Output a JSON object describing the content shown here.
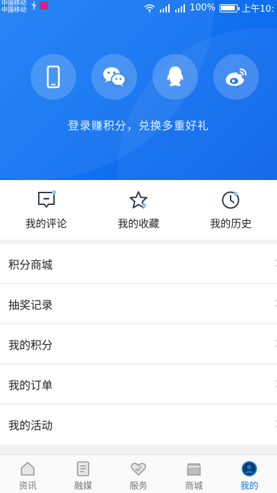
{
  "status": {
    "carrier_1": "中国移动",
    "carrier_2": "中国移动",
    "battery_text": "100%",
    "battery_level": 1.0,
    "time": "上午10:"
  },
  "hero": {
    "login_tip": "登录赚积分，兑换多重好礼",
    "social": [
      {
        "icon": "phone-icon"
      },
      {
        "icon": "wechat-icon"
      },
      {
        "icon": "qq-icon"
      },
      {
        "icon": "weibo-icon"
      }
    ]
  },
  "quick_actions": [
    {
      "label": "我的评论",
      "icon": "comment-icon"
    },
    {
      "label": "我的收藏",
      "icon": "star-icon"
    },
    {
      "label": "我的历史",
      "icon": "clock-icon"
    }
  ],
  "menu": [
    {
      "label": "积分商城"
    },
    {
      "label": "抽奖记录"
    },
    {
      "label": "我的积分"
    },
    {
      "label": "我的订单"
    },
    {
      "label": "我的活动"
    }
  ],
  "tabs": [
    {
      "label": "资讯",
      "icon": "home-icon"
    },
    {
      "label": "融媒",
      "icon": "document-icon"
    },
    {
      "label": "服务",
      "icon": "heart-icon"
    },
    {
      "label": "商城",
      "icon": "shop-icon"
    },
    {
      "label": "我的",
      "icon": "user-icon",
      "active": true
    }
  ],
  "colors": {
    "accent": "#1976d2",
    "hero": "#0f6ff0"
  }
}
